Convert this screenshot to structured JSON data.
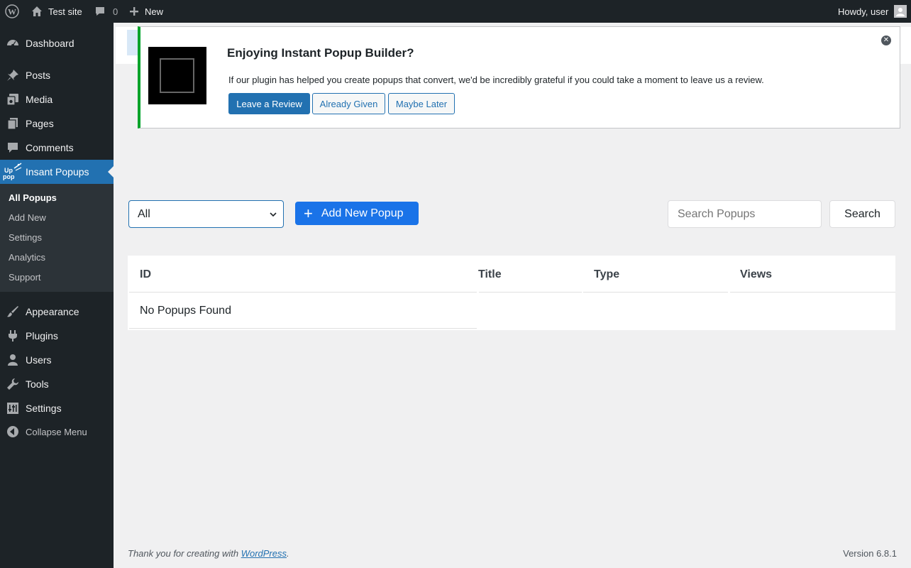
{
  "adminbar": {
    "site_name": "Test site",
    "comments_count": "0",
    "new_label": "New",
    "howdy": "Howdy, user"
  },
  "sidebar": {
    "items": [
      {
        "label": "Dashboard",
        "icon": "dashboard-icon"
      },
      {
        "label": "Posts",
        "icon": "pin-icon"
      },
      {
        "label": "Media",
        "icon": "media-icon"
      },
      {
        "label": "Pages",
        "icon": "pages-icon"
      },
      {
        "label": "Comments",
        "icon": "comments-icon"
      },
      {
        "label": "Insant Popups",
        "icon": "popup-plugin-icon"
      },
      {
        "label": "Appearance",
        "icon": "brush-icon"
      },
      {
        "label": "Plugins",
        "icon": "plug-icon"
      },
      {
        "label": "Users",
        "icon": "user-icon"
      },
      {
        "label": "Tools",
        "icon": "wrench-icon"
      },
      {
        "label": "Settings",
        "icon": "settings-icon"
      },
      {
        "label": "Collapse Menu",
        "icon": "collapse-icon"
      }
    ],
    "submenu": [
      "All Popups",
      "Add New",
      "Settings",
      "Analytics",
      "Support"
    ],
    "plugin_icon_text": "Up pop"
  },
  "notice": {
    "title": "Enjoying Instant Popup Builder?",
    "text": "If our plugin has helped you create popups that convert, we'd be incredibly grateful if you could take a moment to leave us a review.",
    "buttons": {
      "review": "Leave a Review",
      "given": "Already Given",
      "later": "Maybe Later"
    },
    "accent_color": "#00a32a"
  },
  "toolbar": {
    "filter_value": "All",
    "add_label": "Add New Popup",
    "search_placeholder": "Search Popups",
    "search_label": "Search"
  },
  "table": {
    "columns": [
      "ID",
      "Title",
      "Type",
      "Views"
    ],
    "empty_message": "No Popups Found"
  },
  "footer": {
    "thanks_prefix": "Thank you for creating with ",
    "thanks_link": "WordPress",
    "thanks_suffix": ".",
    "version": "Version 6.8.1"
  },
  "colors": {
    "admin_dark": "#1d2327",
    "wp_blue": "#2271b1",
    "button_blue": "#1a73e8"
  }
}
